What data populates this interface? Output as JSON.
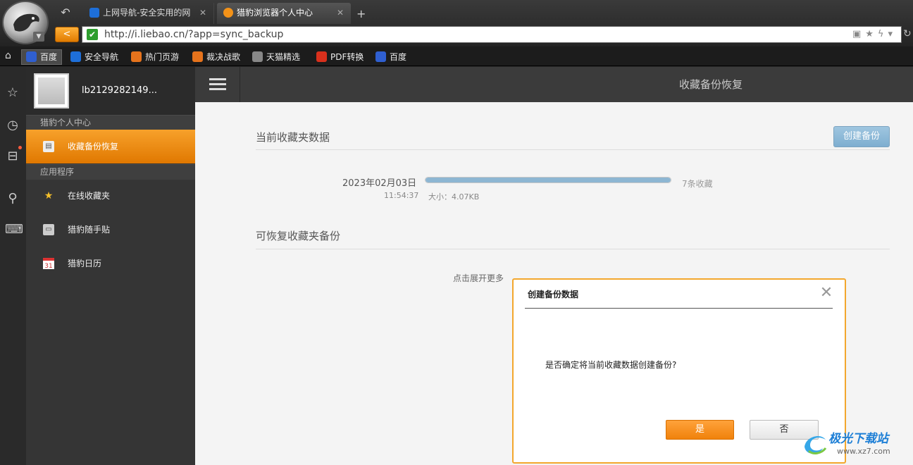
{
  "tabs": [
    {
      "title": "上网导航-安全实用的网",
      "active": false
    },
    {
      "title": "猎豹浏览器个人中心",
      "active": true
    }
  ],
  "toolbar": {
    "new_tab": "+",
    "back_arrow": "<",
    "close_glyph": "✕"
  },
  "address": {
    "url": "http://i.liebao.cn/?app=sync_backup"
  },
  "bookmarks": [
    {
      "label": "百度",
      "color": "#2f5fd0"
    },
    {
      "label": "安全导航",
      "color": "#1e6fd9"
    },
    {
      "label": "热门页游",
      "color": "#e6731c"
    },
    {
      "label": "裁决战歌",
      "color": "#e6731c"
    },
    {
      "label": "天猫精选",
      "color": "#888888"
    },
    {
      "label": "PDF转换",
      "color": "#d9301c"
    },
    {
      "label": "百度",
      "color": "#2f5fd0"
    }
  ],
  "profile": {
    "username": "lb2129282149..."
  },
  "sidebar": {
    "section_personal": "猎豹个人中心",
    "section_apps": "应用程序",
    "items": [
      {
        "label": "收藏备份恢复",
        "icon": "backup-icon",
        "active": true
      },
      {
        "label": "在线收藏夹",
        "icon": "star-icon",
        "active": false
      },
      {
        "label": "猎豹随手贴",
        "icon": "note-icon",
        "active": false
      },
      {
        "label": "猎豹日历",
        "icon": "calendar-icon",
        "active": false
      }
    ]
  },
  "main": {
    "page_title": "收藏备份恢复",
    "current_section": "当前收藏夹数据",
    "create_button": "创建备份",
    "backup": {
      "date": "2023年02月03日",
      "time": "11:54:37",
      "size": "大小：4.07KB",
      "count": "7条收藏",
      "progress": 1.0
    },
    "restore_section": "可恢复收藏夹备份",
    "expand_more": "点击展开更多"
  },
  "dialog": {
    "title": "创建备份数据",
    "message": "是否确定将当前收藏数据创建备份?",
    "yes": "是",
    "no": "否"
  },
  "watermark": {
    "name": "极光下载站",
    "url": "www.xz7.com"
  },
  "colors": {
    "accent": "#f39218",
    "button_blue": "#8fb9d7",
    "dialog_border": "#f3a72d"
  }
}
